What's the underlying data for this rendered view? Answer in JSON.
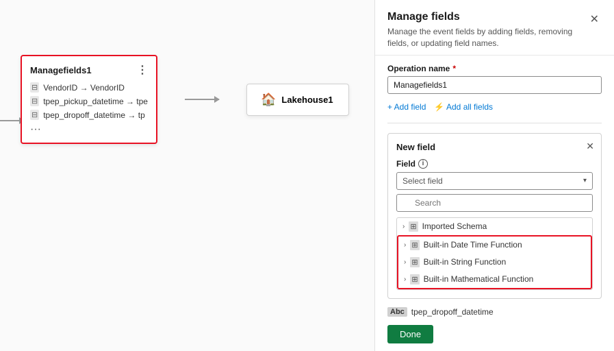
{
  "panel": {
    "title": "Manage fields",
    "description": "Manage the event fields by adding fields, removing fields, or updating field names.",
    "operation_label": "Operation name",
    "operation_value": "Managefields1",
    "add_field_label": "+ Add field",
    "add_all_fields_label": "⚡ Add all fields",
    "new_field_title": "New field",
    "field_label": "Field",
    "select_placeholder": "Select field",
    "search_placeholder": "Search",
    "done_label": "Done",
    "dropdown_items": [
      {
        "label": "Imported Schema",
        "indent": false,
        "highlighted": false
      },
      {
        "label": "Built-in Date Time Function",
        "indent": false,
        "highlighted": true
      },
      {
        "label": "Built-in String Function",
        "indent": false,
        "highlighted": true
      },
      {
        "label": "Built-in Mathematical Function",
        "indent": false,
        "highlighted": true
      }
    ],
    "bottom_field_label": "tpep_dropoff_datetime"
  },
  "canvas": {
    "node1_title": "Managefields1",
    "node1_fields": [
      {
        "source": "VendorID",
        "target": "VendorID"
      },
      {
        "source": "tpep_pickup_datetime",
        "target": "tpe"
      },
      {
        "source": "tpep_dropoff_datetime",
        "target": "tp"
      }
    ],
    "node2_title": "Lakehouse1"
  }
}
